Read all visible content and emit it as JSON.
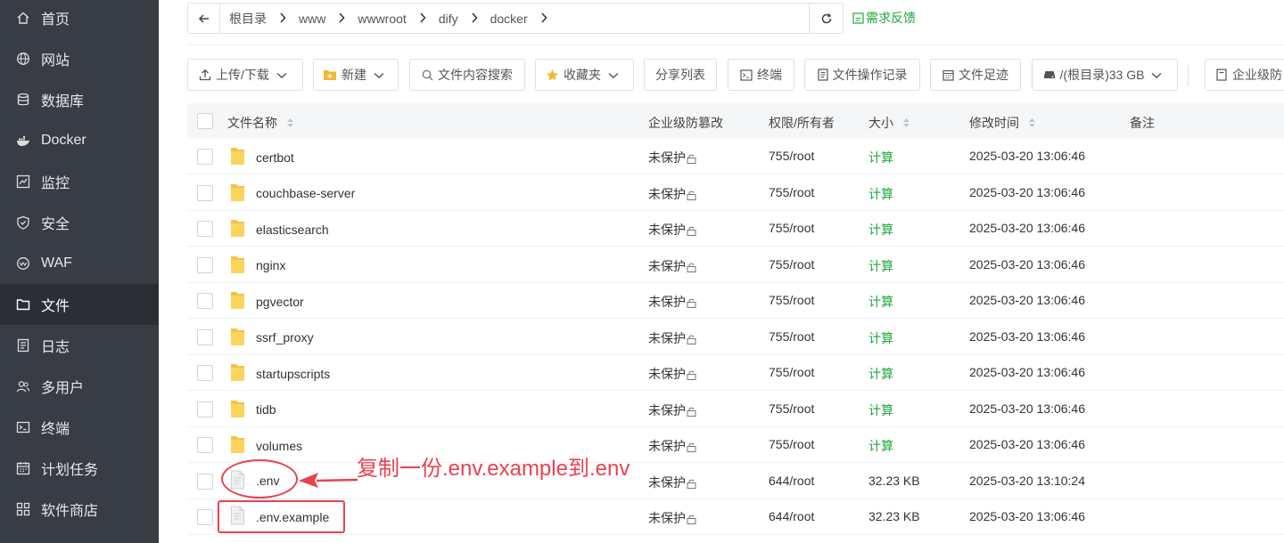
{
  "sidebar": {
    "items": [
      {
        "label": "首页",
        "icon": "home-icon"
      },
      {
        "label": "网站",
        "icon": "globe-icon"
      },
      {
        "label": "数据库",
        "icon": "database-icon"
      },
      {
        "label": "Docker",
        "icon": "docker-icon"
      },
      {
        "label": "监控",
        "icon": "monitor-icon"
      },
      {
        "label": "安全",
        "icon": "shield-icon"
      },
      {
        "label": "WAF",
        "icon": "waf-icon"
      },
      {
        "label": "文件",
        "icon": "folder-icon",
        "active": true
      },
      {
        "label": "日志",
        "icon": "log-icon"
      },
      {
        "label": "多用户",
        "icon": "users-icon"
      },
      {
        "label": "终端",
        "icon": "terminal-icon"
      },
      {
        "label": "计划任务",
        "icon": "calendar-icon"
      },
      {
        "label": "软件商店",
        "icon": "apps-icon"
      }
    ]
  },
  "breadcrumb": {
    "segments": [
      "根目录",
      "www",
      "wwwroot",
      "dify",
      "docker"
    ]
  },
  "feedback_label": "需求反馈",
  "toolbar": {
    "upload": "上传/下载",
    "new": "新建",
    "search": "文件内容搜索",
    "favorites": "收藏夹",
    "share": "分享列表",
    "terminal": "终端",
    "oplog": "文件操作记录",
    "footprint": "文件足迹",
    "disk": "/(根目录)33 GB",
    "enterprise": "企业级防"
  },
  "table": {
    "headers": {
      "name": "文件名称",
      "protect": "企业级防篡改",
      "perm": "权限/所有者",
      "size": "大小",
      "mtime": "修改时间",
      "note": "备注"
    },
    "rows": [
      {
        "name": "certbot",
        "type": "folder",
        "protect": "未保护",
        "perm": "755/root",
        "size": "计算",
        "mtime": "2025-03-20 13:06:46"
      },
      {
        "name": "couchbase-server",
        "type": "folder",
        "protect": "未保护",
        "perm": "755/root",
        "size": "计算",
        "mtime": "2025-03-20 13:06:46"
      },
      {
        "name": "elasticsearch",
        "type": "folder",
        "protect": "未保护",
        "perm": "755/root",
        "size": "计算",
        "mtime": "2025-03-20 13:06:46"
      },
      {
        "name": "nginx",
        "type": "folder",
        "protect": "未保护",
        "perm": "755/root",
        "size": "计算",
        "mtime": "2025-03-20 13:06:46"
      },
      {
        "name": "pgvector",
        "type": "folder",
        "protect": "未保护",
        "perm": "755/root",
        "size": "计算",
        "mtime": "2025-03-20 13:06:46"
      },
      {
        "name": "ssrf_proxy",
        "type": "folder",
        "protect": "未保护",
        "perm": "755/root",
        "size": "计算",
        "mtime": "2025-03-20 13:06:46"
      },
      {
        "name": "startupscripts",
        "type": "folder",
        "protect": "未保护",
        "perm": "755/root",
        "size": "计算",
        "mtime": "2025-03-20 13:06:46"
      },
      {
        "name": "tidb",
        "type": "folder",
        "protect": "未保护",
        "perm": "755/root",
        "size": "计算",
        "mtime": "2025-03-20 13:06:46"
      },
      {
        "name": "volumes",
        "type": "folder",
        "protect": "未保护",
        "perm": "755/root",
        "size": "计算",
        "mtime": "2025-03-20 13:06:46"
      },
      {
        "name": ".env",
        "type": "file",
        "protect": "未保护",
        "perm": "644/root",
        "size": "32.23 KB",
        "mtime": "2025-03-20 13:10:24"
      },
      {
        "name": ".env.example",
        "type": "file",
        "protect": "未保护",
        "perm": "644/root",
        "size": "32.23 KB",
        "mtime": "2025-03-20 13:06:46"
      }
    ]
  },
  "annotation": {
    "text": "复制一份.env.example到.env",
    "color": "#e8424f"
  },
  "colors": {
    "sidebar_bg": "#383c44",
    "accent_green": "#20a53a",
    "annotation_red": "#e8424f"
  }
}
